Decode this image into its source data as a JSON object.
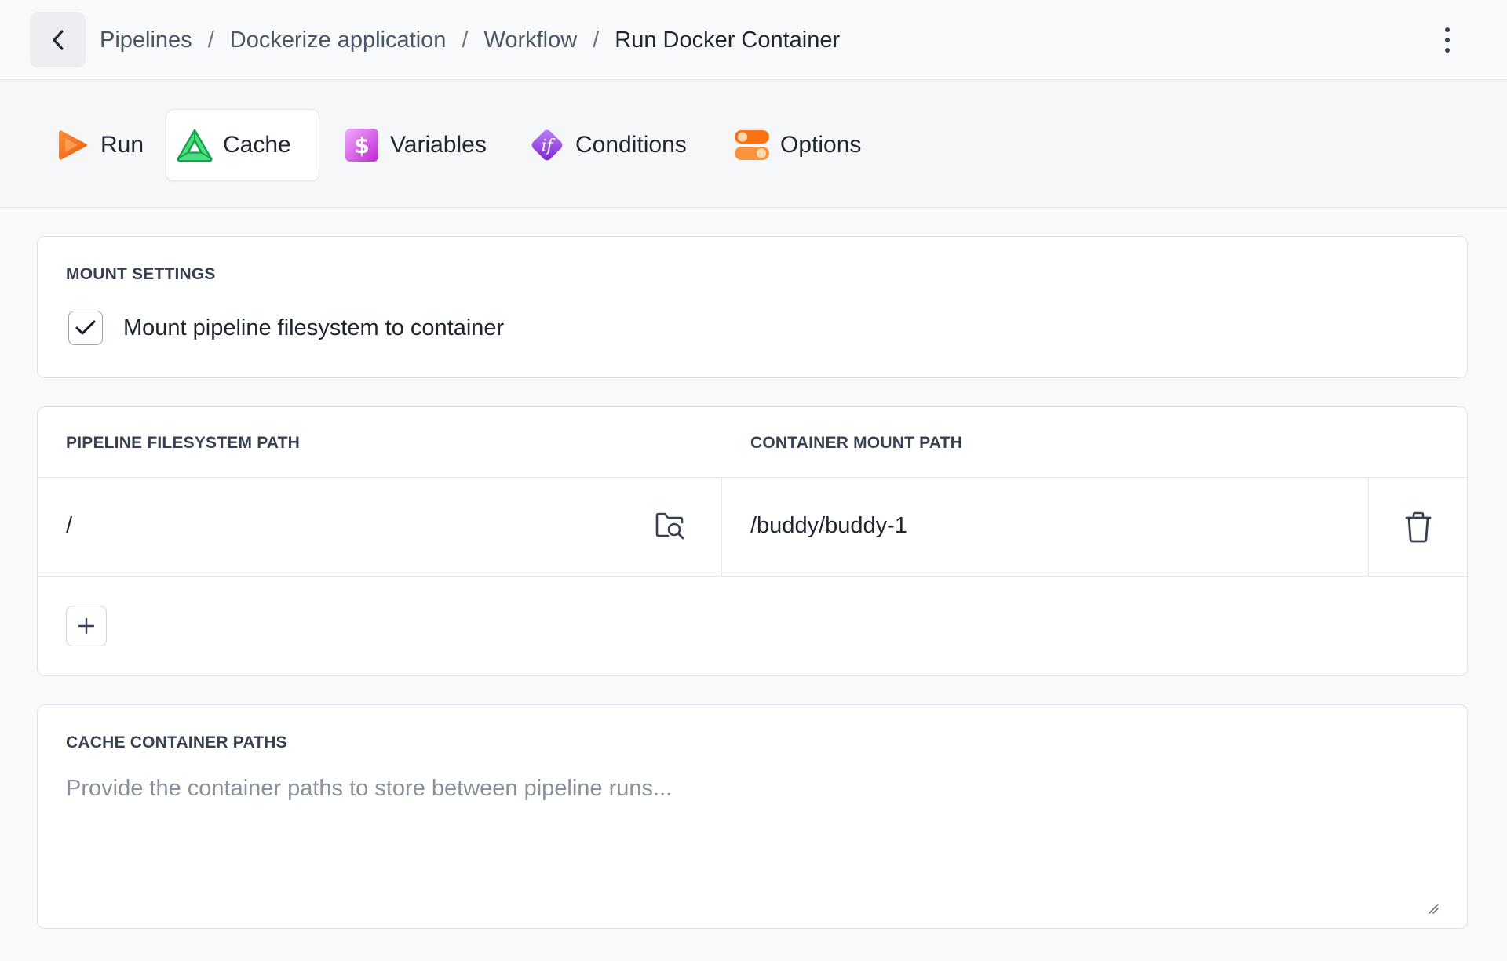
{
  "breadcrumb": {
    "items": [
      "Pipelines",
      "Dockerize application",
      "Workflow",
      "Run Docker Container"
    ],
    "separator": "/"
  },
  "tabs": [
    {
      "label": "Run",
      "icon": "play-icon",
      "active": false
    },
    {
      "label": "Cache",
      "icon": "cache-triangle-icon",
      "active": true
    },
    {
      "label": "Variables",
      "icon": "dollar-icon",
      "active": false
    },
    {
      "label": "Conditions",
      "icon": "if-diamond-icon",
      "active": false
    },
    {
      "label": "Options",
      "icon": "toggles-icon",
      "active": false
    }
  ],
  "mount_settings": {
    "title": "MOUNT SETTINGS",
    "checkbox_label": "Mount pipeline filesystem to container",
    "checked": true
  },
  "paths_table": {
    "col_pipeline": "PIPELINE FILESYSTEM PATH",
    "col_container": "CONTAINER MOUNT PATH",
    "rows": [
      {
        "pipeline_path": "/",
        "container_path": "/buddy/buddy-1"
      }
    ]
  },
  "cache_paths": {
    "title": "CACHE CONTAINER PATHS",
    "placeholder": "Provide the container paths to store between pipeline runs..."
  },
  "colors": {
    "run": "#f97316",
    "cache": "#22c55e",
    "variables": "#d946ef",
    "conditions": "#9333ea",
    "options": "#f97316"
  }
}
